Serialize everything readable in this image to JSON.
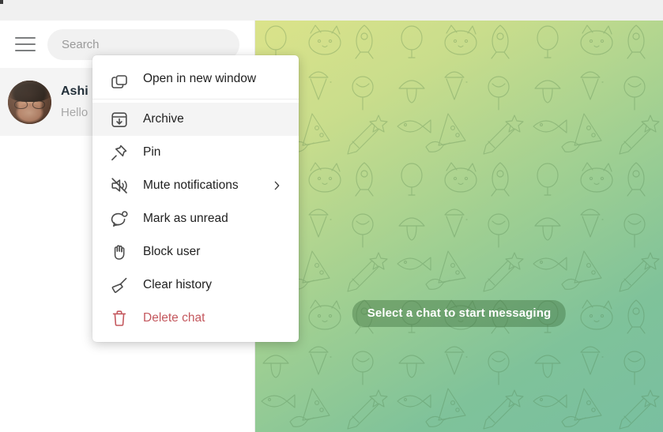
{
  "window": {
    "title": ""
  },
  "sidebar": {
    "menu_icon": "hamburger-icon",
    "search": {
      "placeholder": "Search",
      "value": ""
    },
    "chats": [
      {
        "name": "Ashi",
        "preview": "Hello",
        "avatar": "user-photo-avatar",
        "selected": true
      }
    ]
  },
  "right_pane": {
    "empty_state_label": "Select a chat to start messaging",
    "background": "telegram-doodle-pattern",
    "gradient": [
      "#dbe38a",
      "#9fcf92",
      "#79bfa0"
    ],
    "pill_color": "#3c6e3c"
  },
  "context_menu": {
    "items": [
      {
        "label": "Open in new window",
        "icon": "new-window-icon",
        "danger": false,
        "hovered": false,
        "submenu": false,
        "separator_after": true
      },
      {
        "label": "Archive",
        "icon": "archive-icon",
        "danger": false,
        "hovered": true,
        "submenu": false,
        "separator_after": false
      },
      {
        "label": "Pin",
        "icon": "pin-icon",
        "danger": false,
        "hovered": false,
        "submenu": false,
        "separator_after": false
      },
      {
        "label": "Mute notifications",
        "icon": "mute-icon",
        "danger": false,
        "hovered": false,
        "submenu": true,
        "separator_after": false
      },
      {
        "label": "Mark as unread",
        "icon": "unread-bubble-icon",
        "danger": false,
        "hovered": false,
        "submenu": false,
        "separator_after": false
      },
      {
        "label": "Block user",
        "icon": "block-hand-icon",
        "danger": false,
        "hovered": false,
        "submenu": false,
        "separator_after": false
      },
      {
        "label": "Clear history",
        "icon": "broom-icon",
        "danger": false,
        "hovered": false,
        "submenu": false,
        "separator_after": false
      },
      {
        "label": "Delete chat",
        "icon": "trash-icon",
        "danger": true,
        "hovered": false,
        "submenu": false,
        "separator_after": false
      }
    ],
    "submenu_indicator": "chevron-right-icon",
    "danger_color": "#c4585e"
  }
}
